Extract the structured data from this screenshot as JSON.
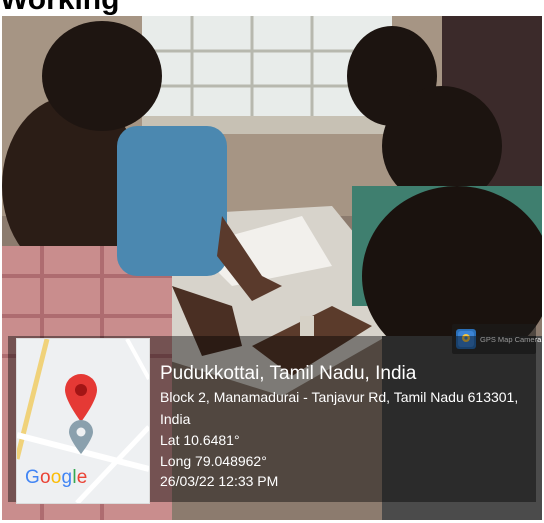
{
  "heading": {
    "text": "Working"
  },
  "photo": {
    "subject": "students-collaborating-around-table"
  },
  "gps_badge": {
    "icon": "gps-map-camera-icon",
    "label": "GPS Map Camera"
  },
  "map": {
    "pin_icon": "map-pin-icon",
    "brand": "Google",
    "brand_colors": [
      "#4285F4",
      "#EA4335",
      "#FBBC05",
      "#4285F4",
      "#34A853",
      "#EA4335"
    ]
  },
  "geotag": {
    "place": "Pudukkottai, Tamil Nadu, India",
    "address": "Block 2, Manamadurai - Tanjavur Rd, Tamil Nadu 613301, India",
    "lat": "Lat 10.6481°",
    "long": "Long 79.048962°",
    "datetime": "26/03/22 12:33 PM"
  }
}
